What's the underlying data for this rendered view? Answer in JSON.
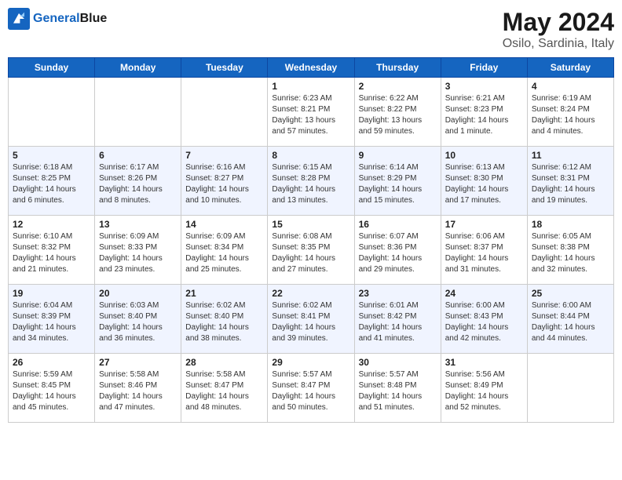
{
  "header": {
    "logo_line1": "General",
    "logo_line2": "Blue",
    "month": "May 2024",
    "location": "Osilo, Sardinia, Italy"
  },
  "weekdays": [
    "Sunday",
    "Monday",
    "Tuesday",
    "Wednesday",
    "Thursday",
    "Friday",
    "Saturday"
  ],
  "weeks": [
    [
      {
        "day": "",
        "info": ""
      },
      {
        "day": "",
        "info": ""
      },
      {
        "day": "",
        "info": ""
      },
      {
        "day": "1",
        "info": "Sunrise: 6:23 AM\nSunset: 8:21 PM\nDaylight: 13 hours\nand 57 minutes."
      },
      {
        "day": "2",
        "info": "Sunrise: 6:22 AM\nSunset: 8:22 PM\nDaylight: 13 hours\nand 59 minutes."
      },
      {
        "day": "3",
        "info": "Sunrise: 6:21 AM\nSunset: 8:23 PM\nDaylight: 14 hours\nand 1 minute."
      },
      {
        "day": "4",
        "info": "Sunrise: 6:19 AM\nSunset: 8:24 PM\nDaylight: 14 hours\nand 4 minutes."
      }
    ],
    [
      {
        "day": "5",
        "info": "Sunrise: 6:18 AM\nSunset: 8:25 PM\nDaylight: 14 hours\nand 6 minutes."
      },
      {
        "day": "6",
        "info": "Sunrise: 6:17 AM\nSunset: 8:26 PM\nDaylight: 14 hours\nand 8 minutes."
      },
      {
        "day": "7",
        "info": "Sunrise: 6:16 AM\nSunset: 8:27 PM\nDaylight: 14 hours\nand 10 minutes."
      },
      {
        "day": "8",
        "info": "Sunrise: 6:15 AM\nSunset: 8:28 PM\nDaylight: 14 hours\nand 13 minutes."
      },
      {
        "day": "9",
        "info": "Sunrise: 6:14 AM\nSunset: 8:29 PM\nDaylight: 14 hours\nand 15 minutes."
      },
      {
        "day": "10",
        "info": "Sunrise: 6:13 AM\nSunset: 8:30 PM\nDaylight: 14 hours\nand 17 minutes."
      },
      {
        "day": "11",
        "info": "Sunrise: 6:12 AM\nSunset: 8:31 PM\nDaylight: 14 hours\nand 19 minutes."
      }
    ],
    [
      {
        "day": "12",
        "info": "Sunrise: 6:10 AM\nSunset: 8:32 PM\nDaylight: 14 hours\nand 21 minutes."
      },
      {
        "day": "13",
        "info": "Sunrise: 6:09 AM\nSunset: 8:33 PM\nDaylight: 14 hours\nand 23 minutes."
      },
      {
        "day": "14",
        "info": "Sunrise: 6:09 AM\nSunset: 8:34 PM\nDaylight: 14 hours\nand 25 minutes."
      },
      {
        "day": "15",
        "info": "Sunrise: 6:08 AM\nSunset: 8:35 PM\nDaylight: 14 hours\nand 27 minutes."
      },
      {
        "day": "16",
        "info": "Sunrise: 6:07 AM\nSunset: 8:36 PM\nDaylight: 14 hours\nand 29 minutes."
      },
      {
        "day": "17",
        "info": "Sunrise: 6:06 AM\nSunset: 8:37 PM\nDaylight: 14 hours\nand 31 minutes."
      },
      {
        "day": "18",
        "info": "Sunrise: 6:05 AM\nSunset: 8:38 PM\nDaylight: 14 hours\nand 32 minutes."
      }
    ],
    [
      {
        "day": "19",
        "info": "Sunrise: 6:04 AM\nSunset: 8:39 PM\nDaylight: 14 hours\nand 34 minutes."
      },
      {
        "day": "20",
        "info": "Sunrise: 6:03 AM\nSunset: 8:40 PM\nDaylight: 14 hours\nand 36 minutes."
      },
      {
        "day": "21",
        "info": "Sunrise: 6:02 AM\nSunset: 8:40 PM\nDaylight: 14 hours\nand 38 minutes."
      },
      {
        "day": "22",
        "info": "Sunrise: 6:02 AM\nSunset: 8:41 PM\nDaylight: 14 hours\nand 39 minutes."
      },
      {
        "day": "23",
        "info": "Sunrise: 6:01 AM\nSunset: 8:42 PM\nDaylight: 14 hours\nand 41 minutes."
      },
      {
        "day": "24",
        "info": "Sunrise: 6:00 AM\nSunset: 8:43 PM\nDaylight: 14 hours\nand 42 minutes."
      },
      {
        "day": "25",
        "info": "Sunrise: 6:00 AM\nSunset: 8:44 PM\nDaylight: 14 hours\nand 44 minutes."
      }
    ],
    [
      {
        "day": "26",
        "info": "Sunrise: 5:59 AM\nSunset: 8:45 PM\nDaylight: 14 hours\nand 45 minutes."
      },
      {
        "day": "27",
        "info": "Sunrise: 5:58 AM\nSunset: 8:46 PM\nDaylight: 14 hours\nand 47 minutes."
      },
      {
        "day": "28",
        "info": "Sunrise: 5:58 AM\nSunset: 8:47 PM\nDaylight: 14 hours\nand 48 minutes."
      },
      {
        "day": "29",
        "info": "Sunrise: 5:57 AM\nSunset: 8:47 PM\nDaylight: 14 hours\nand 50 minutes."
      },
      {
        "day": "30",
        "info": "Sunrise: 5:57 AM\nSunset: 8:48 PM\nDaylight: 14 hours\nand 51 minutes."
      },
      {
        "day": "31",
        "info": "Sunrise: 5:56 AM\nSunset: 8:49 PM\nDaylight: 14 hours\nand 52 minutes."
      },
      {
        "day": "",
        "info": ""
      }
    ]
  ]
}
